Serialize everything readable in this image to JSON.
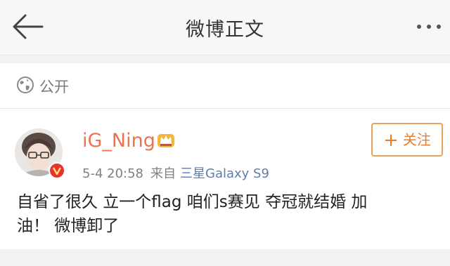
{
  "header": {
    "title": "微博正文"
  },
  "visibility": {
    "label": "公开"
  },
  "post": {
    "username": "iG_Ning",
    "time": "5-4 20:58",
    "source_prefix": "来自",
    "device": "三星Galaxy S9",
    "follow_label": "关注",
    "follow_plus": "+",
    "content_line1": "自省了很久 立一个flag 咱们s赛见 夺冠就结婚 加",
    "content_line2": "油！ 微博卸了"
  },
  "colors": {
    "username": "#eb7350",
    "device_link": "#5d7fa6",
    "follow_border": "#e9a25c",
    "verified_badge": "#e8322a"
  },
  "icons": [
    "back-arrow-icon",
    "more-icon",
    "globe-icon",
    "verified-icon",
    "member-crown-icon",
    "plus-icon"
  ]
}
